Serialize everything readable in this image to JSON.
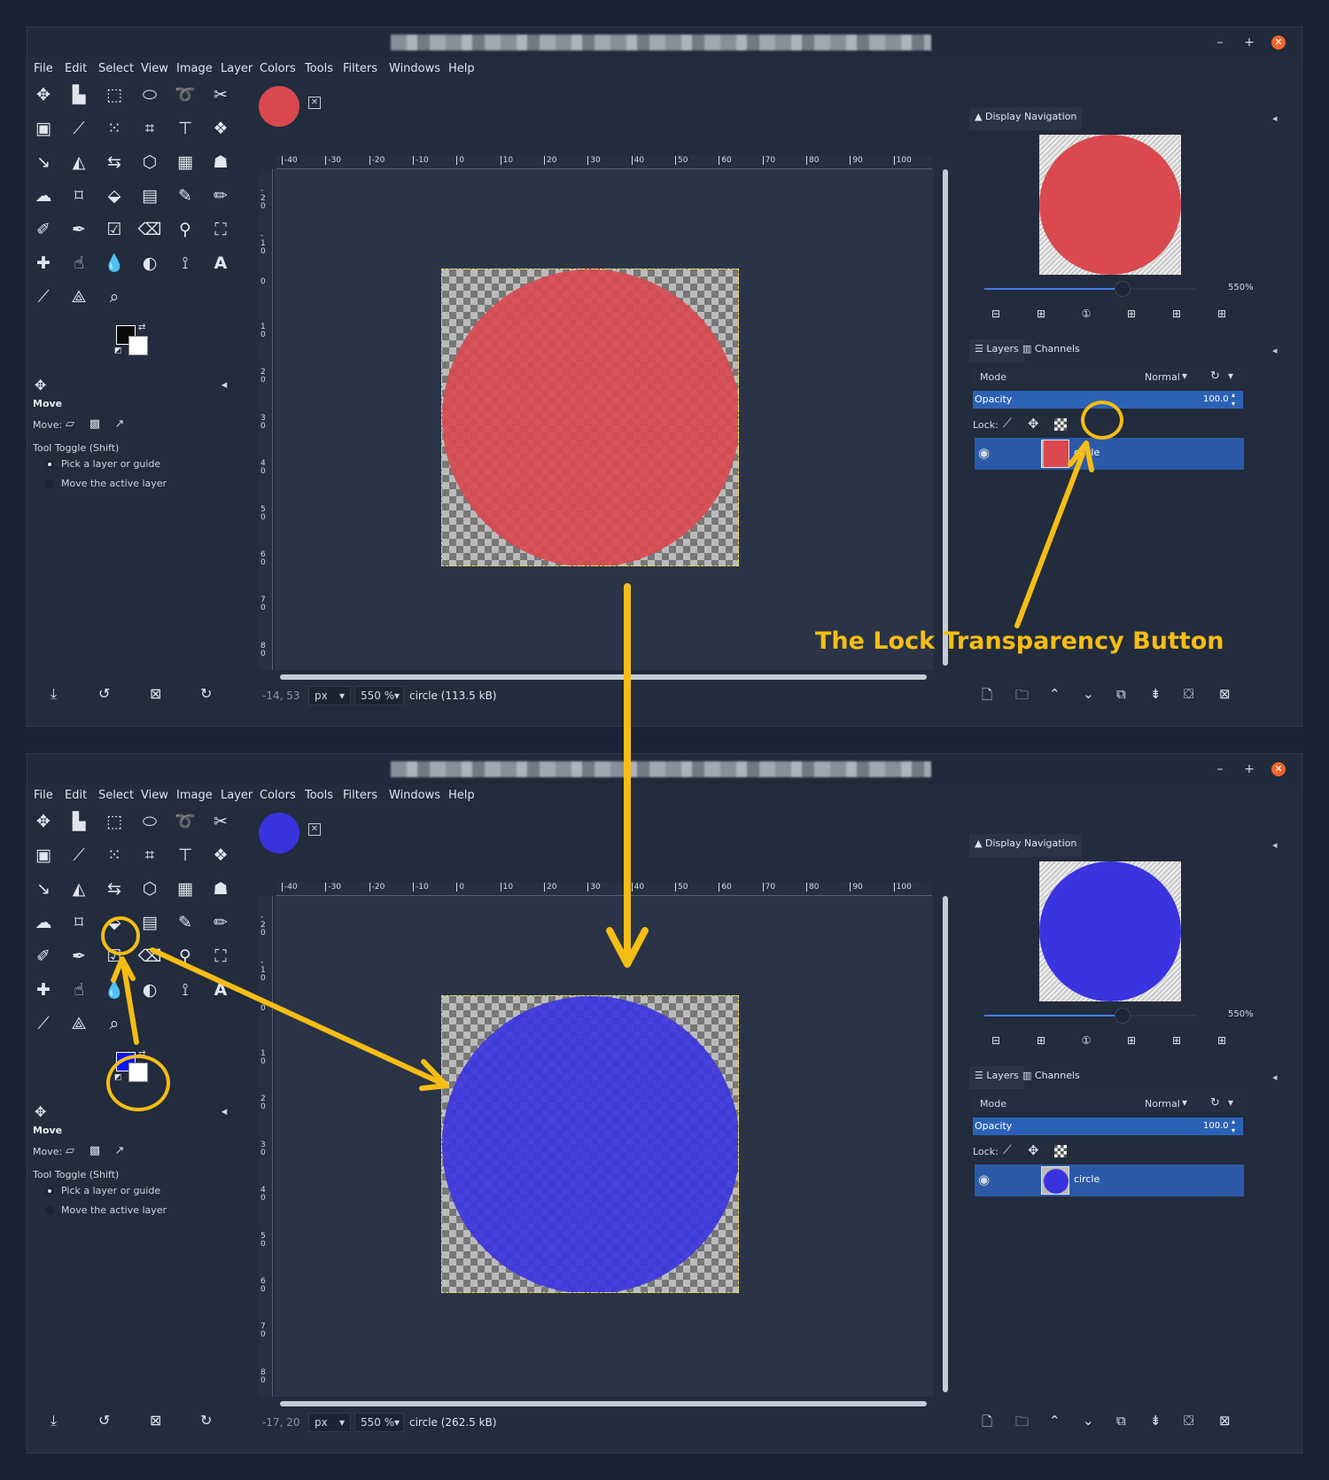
{
  "menu": [
    "File",
    "Edit",
    "Select",
    "View",
    "Image",
    "Layer",
    "Colors",
    "Tools",
    "Filters",
    "Windows",
    "Help"
  ],
  "tool_options": {
    "title": "Move",
    "move_label": "Move:",
    "toggle_label": "Tool Toggle  (Shift)",
    "option_pick": "Pick a layer or guide",
    "option_move": "Move the active layer"
  },
  "ruler_top_labels": [
    "-40",
    "-30",
    "-20",
    "-10",
    "0",
    "10",
    "20",
    "30",
    "40",
    "50",
    "60",
    "70",
    "80",
    "90",
    "100"
  ],
  "ruler_left_labels": [
    "-20",
    "-10",
    "0",
    "10",
    "20",
    "30",
    "40",
    "50",
    "60",
    "70",
    "80"
  ],
  "units": "px",
  "zoom": "550 %",
  "dock": {
    "nav_tab": "Display Navigation",
    "nav_zoom": "550%",
    "layers_tab": "Layers",
    "channels_tab": "Channels",
    "mode_label": "Mode",
    "mode_value": "Normal",
    "opacity_label": "Opacity",
    "opacity_value": "100.0",
    "lock_label": "Lock:",
    "layer_name": "circle"
  },
  "top": {
    "coords": "-14, 53",
    "status": "circle (113.5 kB)",
    "circle_color": "#d9494f",
    "fg_color": "#0a0a0a"
  },
  "bottom": {
    "coords": "-17, 20",
    "status": "circle (262.5 kB)",
    "circle_color": "#3a33e0",
    "fg_color": "#0a14ff"
  },
  "annotation": {
    "label": "The Lock Transparency Button",
    "color": "#f5bd15"
  }
}
